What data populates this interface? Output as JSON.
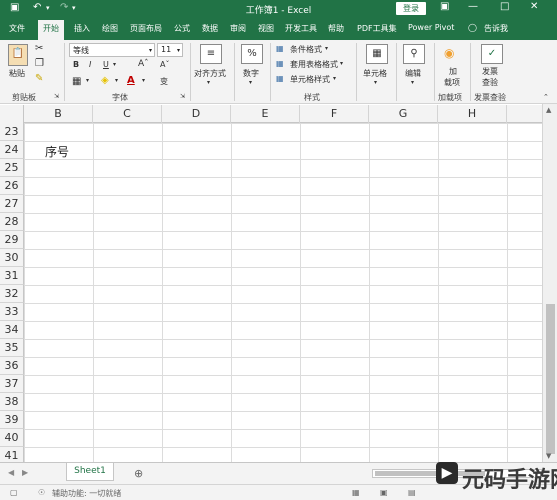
{
  "title_bar": {
    "title": "工作簿1 - Excel",
    "login_label": "登录",
    "save_icon": "save-icon",
    "undo_icon": "undo-icon",
    "redo_icon": "redo-icon"
  },
  "tabs": [
    "文件",
    "开始",
    "插入",
    "绘图",
    "页面布局",
    "公式",
    "数据",
    "审阅",
    "视图",
    "开发工具",
    "帮助",
    "PDF工具集",
    "Power Pivot",
    "告诉我"
  ],
  "active_tab": "开始",
  "ribbon": {
    "paste_label": "粘贴",
    "clipboard_label": "剪贴板",
    "font_name": "等线",
    "font_size": "11",
    "font_group_label": "字体",
    "align_label": "对齐方式",
    "number_label": "数字",
    "percent_symbol": "%",
    "cond_format": "条件格式",
    "table_format": "套用表格格式",
    "cell_style": "单元格样式",
    "style_group_label": "样式",
    "cells_label": "单元格",
    "edit_label": "编辑",
    "addin_label_1": "加",
    "addin_label_2": "载项",
    "addin_group_label": "加载项",
    "check_label_1": "发票",
    "check_label_2": "查验",
    "check_group_label": "发票查验",
    "bold": "B",
    "italic": "I",
    "underline": "U",
    "font_color_glyph": "A"
  },
  "columns": [
    "B",
    "C",
    "D",
    "E",
    "F",
    "G",
    "H"
  ],
  "rows": [
    "23",
    "24",
    "25",
    "26",
    "27",
    "28",
    "29",
    "30",
    "31",
    "32",
    "33",
    "34",
    "35",
    "36",
    "37",
    "38",
    "39",
    "40",
    "41"
  ],
  "cell_b24": "序号",
  "sheet_tab": "Sheet1",
  "add_sheet": "⊕",
  "status_text": "辅助功能: 一切就绪",
  "watermark": "元码手游网",
  "accent_color": "#217346"
}
